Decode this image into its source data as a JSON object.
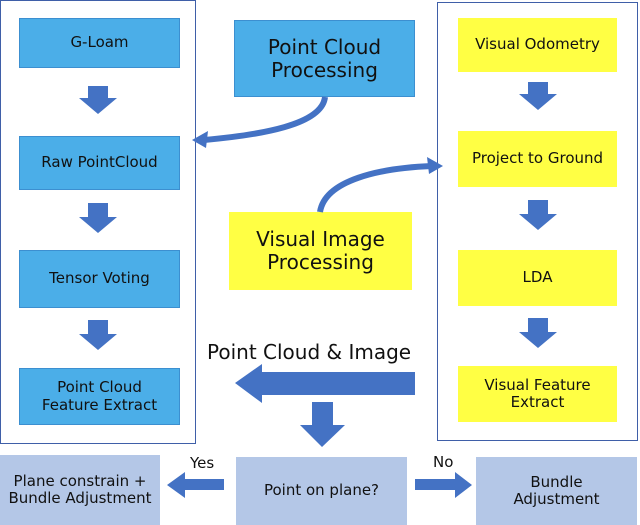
{
  "left_column": [
    "G-Loam",
    "Raw PointCloud",
    "Tensor Voting",
    "Point Cloud Feature Extract"
  ],
  "right_column": [
    "Visual Odometry",
    "Project to Ground",
    "LDA",
    "Visual Feature Extract"
  ],
  "center": {
    "point_cloud_processing": "Point Cloud Processing",
    "visual_image_processing": "Visual Image Processing",
    "merge_label": "Point Cloud & Image"
  },
  "bottom": {
    "decision": "Point on plane?",
    "yes_label": "Yes",
    "no_label": "No",
    "yes_result": "Plane constrain + Bundle Adjustment",
    "no_result": "Bundle Adjustment"
  },
  "colors": {
    "point_cloud": "#4BAEE8",
    "visual": "#FFFF44",
    "bottom": "#B4C7E7",
    "arrow": "#4472C4"
  }
}
